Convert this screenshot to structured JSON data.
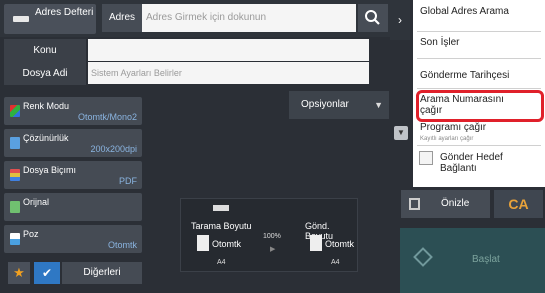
{
  "header": {
    "address_book_label": "Adres Defteri",
    "address_label": "Adres",
    "address_placeholder": "Adres Girmek için dokunun"
  },
  "fields": {
    "subject_label": "Konu",
    "filename_label": "Dosya Adi",
    "filename_placeholder": "Sistem Ayarları Belirler"
  },
  "settings": [
    {
      "label": "Renk Modu",
      "value": "Otomtk/Mono2"
    },
    {
      "label": "Çözünürlük",
      "value": "200x200dpi"
    },
    {
      "label": "Dosya Biçımı",
      "value": "PDF"
    },
    {
      "label": "Orijnal",
      "value": ""
    },
    {
      "label": "Poz",
      "value": "Otomtk"
    }
  ],
  "options_label": "Opsiyonlar",
  "preview": {
    "scan_size_label": "Tarama Boyutu",
    "send_size_label": "Gönd. Boyutu",
    "scan_mode": "Otomtk",
    "send_mode": "Otomtk",
    "scale": "100%",
    "scan_paper": "A4",
    "send_paper": "A4"
  },
  "bottom": {
    "others_label": "Diğerleri"
  },
  "side": {
    "preview_label": "Önizle",
    "ca_label": "CA",
    "start_label": "Başlat"
  },
  "menu": {
    "global_search": "Global Adres Arama",
    "job_status": "Son İşler",
    "send_history": "Gönderme Tarihçesi",
    "call_number": "Arama Numarasını çağır",
    "call_program": "Programı çağır",
    "registered_settings": "Kayıtlı ayarları çağır",
    "send_target": "Gönder Hedef Bağlantı"
  },
  "colors": {
    "highlight": "#e0202a",
    "accent": "#2f78c4",
    "value_text": "#8ab4e0"
  }
}
